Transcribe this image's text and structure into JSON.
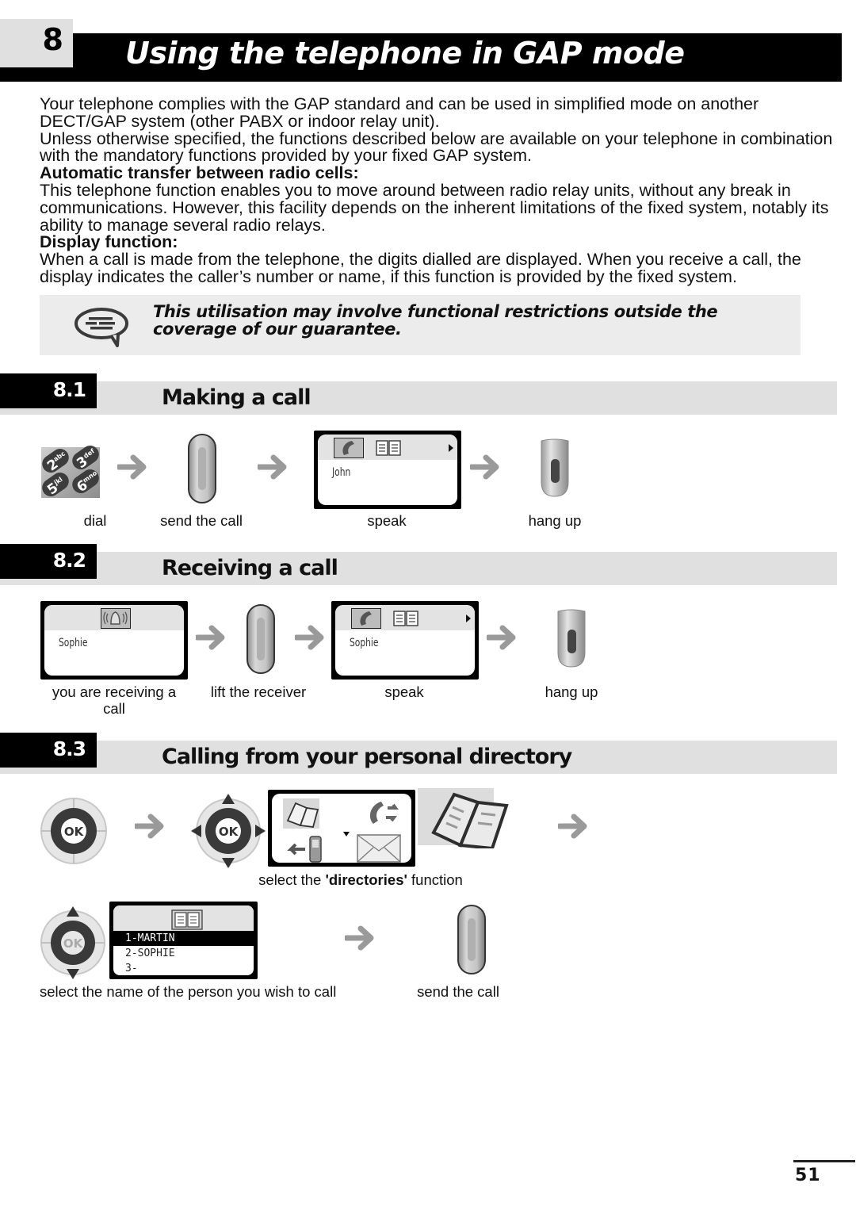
{
  "chapter": {
    "number": "8",
    "title": "Using the telephone in GAP mode"
  },
  "intro": {
    "p1": "Your telephone complies with the GAP standard and can be used in simplified mode on another DECT/GAP system (other PABX or indoor relay unit).",
    "p2": "Unless otherwise specified, the functions described below are available on your telephone in combination with the mandatory functions provided by your fixed GAP system.",
    "h1": "Automatic transfer between radio cells:",
    "p3": "This telephone function enables you to move around between radio relay units, without any break in communications. However, this facility depends on the inherent limitations of the fixed system, notably its ability to manage several radio relays.",
    "h2": "Display function:",
    "p4": "When a call is made from the telephone, the digits dialled are displayed. When you receive a call, the display indicates the caller’s number or name, if this function is provided by the fixed system."
  },
  "note": {
    "icon": "speech-bubble-icon",
    "text": "This utilisation may involve functional restrictions outside the coverage of our guarantee."
  },
  "sections": [
    {
      "number": "8.1",
      "title": "Making a call",
      "steps": [
        {
          "icon": "keypad-icon",
          "keys": [
            "2abc",
            "3def",
            "5jkl",
            "6mno"
          ],
          "caption": "dial"
        },
        {
          "icon": "green-call-key-icon",
          "caption": "send the call"
        },
        {
          "icon": "screen-call-in-progress",
          "screen_name": "John",
          "caption": "speak"
        },
        {
          "icon": "red-hangup-key-icon",
          "caption": "hang up"
        }
      ]
    },
    {
      "number": "8.2",
      "title": "Receiving a call",
      "steps": [
        {
          "icon": "screen-incoming-call",
          "screen_name": "Sophie",
          "caption": "you are receiving a call"
        },
        {
          "icon": "green-call-key-icon",
          "caption": "lift the receiver"
        },
        {
          "icon": "screen-call-in-progress",
          "screen_name": "Sophie",
          "caption": "speak"
        },
        {
          "icon": "red-hangup-key-icon",
          "caption": "hang up"
        }
      ]
    },
    {
      "number": "8.3",
      "title": "Calling from your personal directory",
      "row1": {
        "caption_prefix": "select the ",
        "caption_bold": "'directories'",
        "caption_suffix": " function",
        "ok_label": "OK"
      },
      "row2": {
        "directory_entries": [
          "1-MARTIN",
          "2-SOPHIE",
          "3-"
        ],
        "selected_index": 0,
        "caption_select": "select the name of the person you wish to call",
        "caption_send": "send the call",
        "ok_label": "OK"
      }
    }
  ],
  "page_number": "51"
}
